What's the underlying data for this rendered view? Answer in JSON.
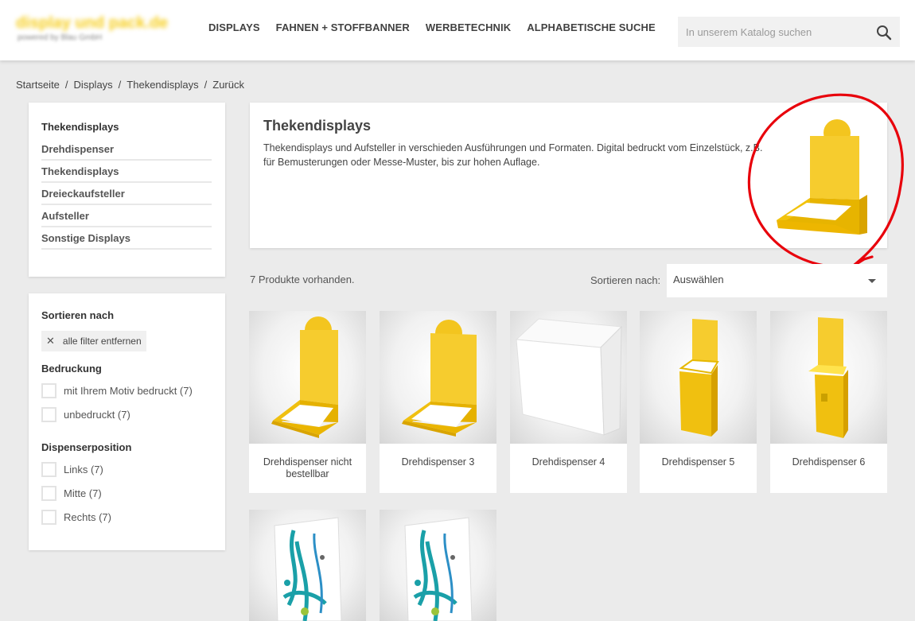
{
  "header": {
    "logo_text": "display und pack.de",
    "logo_sub": "powered by Blau GmbH",
    "nav": [
      "DISPLAYS",
      "FAHNEN + STOFFBANNER",
      "WERBETECHNIK",
      "ALPHABETISCHE SUCHE"
    ],
    "search_placeholder": "In unserem Katalog suchen"
  },
  "breadcrumb": [
    "Startseite",
    "Displays",
    "Thekendisplays",
    "Zurück"
  ],
  "categories": {
    "title": "Thekendisplays",
    "items": [
      "Drehdispenser",
      "Thekendisplays",
      "Dreieckaufsteller",
      "Aufsteller",
      "Sonstige Displays"
    ]
  },
  "filters": {
    "title": "Sortieren nach",
    "clear_label": "alle filter entfernen",
    "facets": [
      {
        "title": "Bedruckung",
        "options": [
          "mit Ihrem Motiv bedruckt (7)",
          "unbedruckt (7)"
        ]
      },
      {
        "title": "Dispenserposition",
        "options": [
          "Links (7)",
          "Mitte (7)",
          "Rechts (7)"
        ]
      }
    ]
  },
  "category_header": {
    "title": "Thekendisplays",
    "description": "Thekendisplays und Aufsteller in verschieden Ausführungen und Formaten. Digital bedruckt vom Einzelstück, z.B. für Bemusterungen oder Messe-Muster, bis zur hohen Auflage."
  },
  "listing": {
    "count_text": "7 Produkte vorhanden.",
    "sort_label": "Sortieren nach:",
    "sort_value": "Auswählen"
  },
  "products": [
    {
      "name": "Drehdispenser nicht bestellbar"
    },
    {
      "name": "Drehdispenser 3"
    },
    {
      "name": "Drehdispenser 4"
    },
    {
      "name": "Drehdispenser 5"
    },
    {
      "name": "Drehdispenser 6"
    },
    {
      "name": ""
    },
    {
      "name": ""
    }
  ],
  "colors": {
    "accent": "#f6c500",
    "annotation": "#e8000b"
  }
}
